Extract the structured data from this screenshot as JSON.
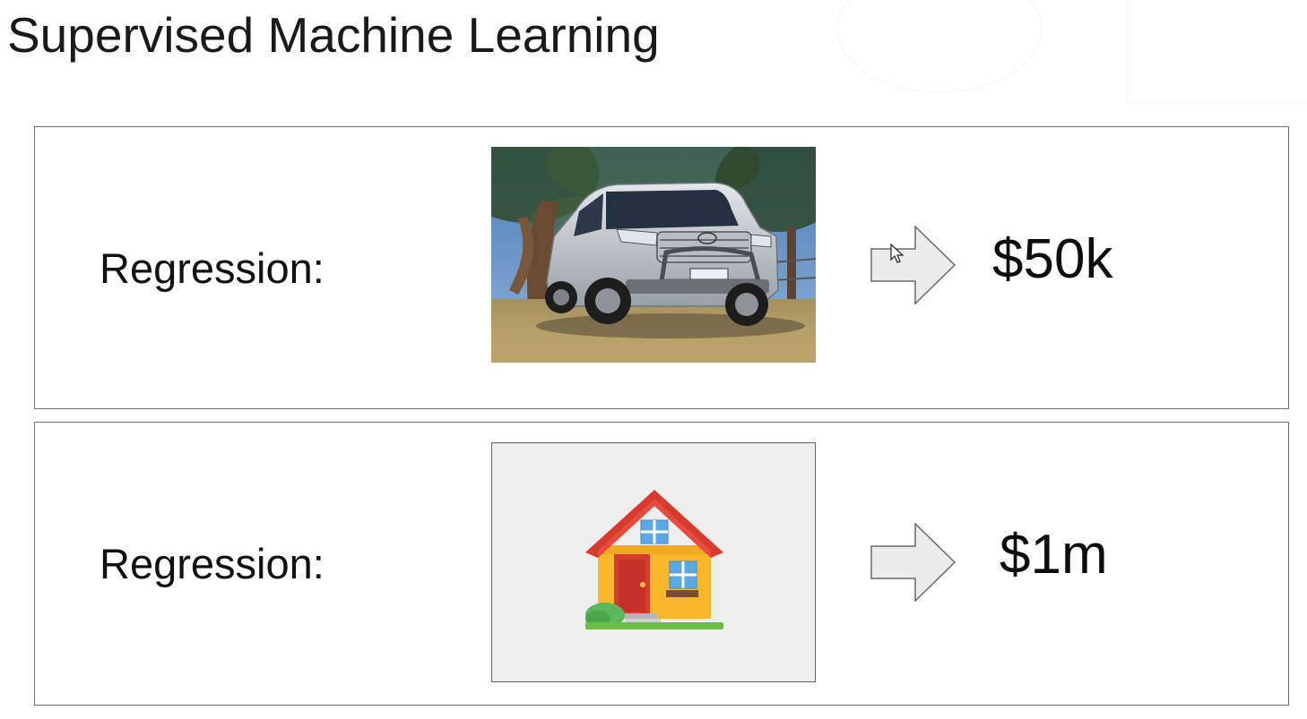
{
  "slide": {
    "title": "Supervised Machine Learning"
  },
  "examples": [
    {
      "label": "Regression:",
      "input_icon": "pickup-truck-photo",
      "arrow_icon": "right-arrow-icon",
      "output": "$50k"
    },
    {
      "label": "Regression:",
      "input_icon": "house-emoji-icon",
      "arrow_icon": "right-arrow-icon",
      "output": "$1m"
    }
  ]
}
